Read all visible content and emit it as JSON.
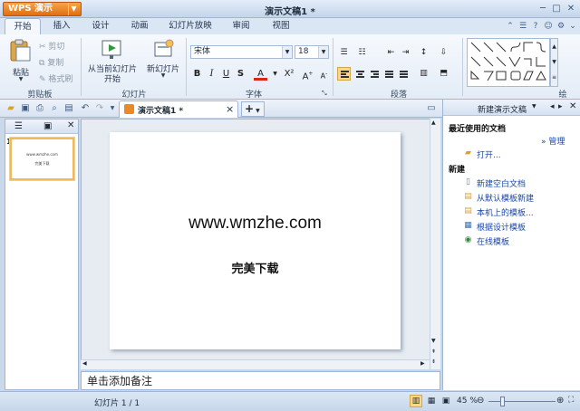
{
  "titlebar": {
    "app_button": "WPS 演示",
    "doc_title": "演示文稿1 *"
  },
  "tabs": [
    "开始",
    "插入",
    "设计",
    "动画",
    "幻灯片放映",
    "审阅",
    "视图"
  ],
  "active_tab": 0,
  "ribbon": {
    "paste": "粘贴",
    "cut": "剪切",
    "copy": "复制",
    "format_painter": "格式刷",
    "clipboard_label": "剪贴板",
    "from_current_line1": "从当前幻灯片",
    "from_current_line2": "开始",
    "new_slide": "新幻灯片",
    "slides_label": "幻灯片",
    "font_name": "宋体",
    "font_size": "18",
    "font_label": "字体",
    "bold": "B",
    "italic": "I",
    "underline": "U",
    "shadow": "S",
    "font_color": "A",
    "superscript": "X²",
    "grow": "A",
    "shrink": "A",
    "paragraph_label": "段落",
    "drawing_label": "绘"
  },
  "doc_tab": {
    "title": "演示文稿1 *",
    "close": "×",
    "add": "+"
  },
  "slides_panel": {
    "slide_number": "1",
    "thumb_title": "www.wmzhe.com",
    "thumb_subtitle": "完美下载"
  },
  "slide": {
    "title": "www.wmzhe.com",
    "subtitle": "完美下载"
  },
  "notes": {
    "placeholder": "单击添加备注"
  },
  "task_pane": {
    "title": "新建演示文稿",
    "recent_heading": "最近使用的文档",
    "manage": "管理",
    "open": "打开...",
    "new_heading": "新建",
    "links": [
      "新建空白文档",
      "从默认模板新建",
      "本机上的模板...",
      "根据设计模板",
      "在线模板"
    ]
  },
  "statusbar": {
    "slide_info": "幻灯片 1 / 1",
    "zoom": "45 %"
  },
  "colors": {
    "accent_orange": "#e8821f",
    "link_blue": "#1a47a8",
    "ribbon_bg": "#e3ecf7",
    "selected": "#fbd889"
  }
}
